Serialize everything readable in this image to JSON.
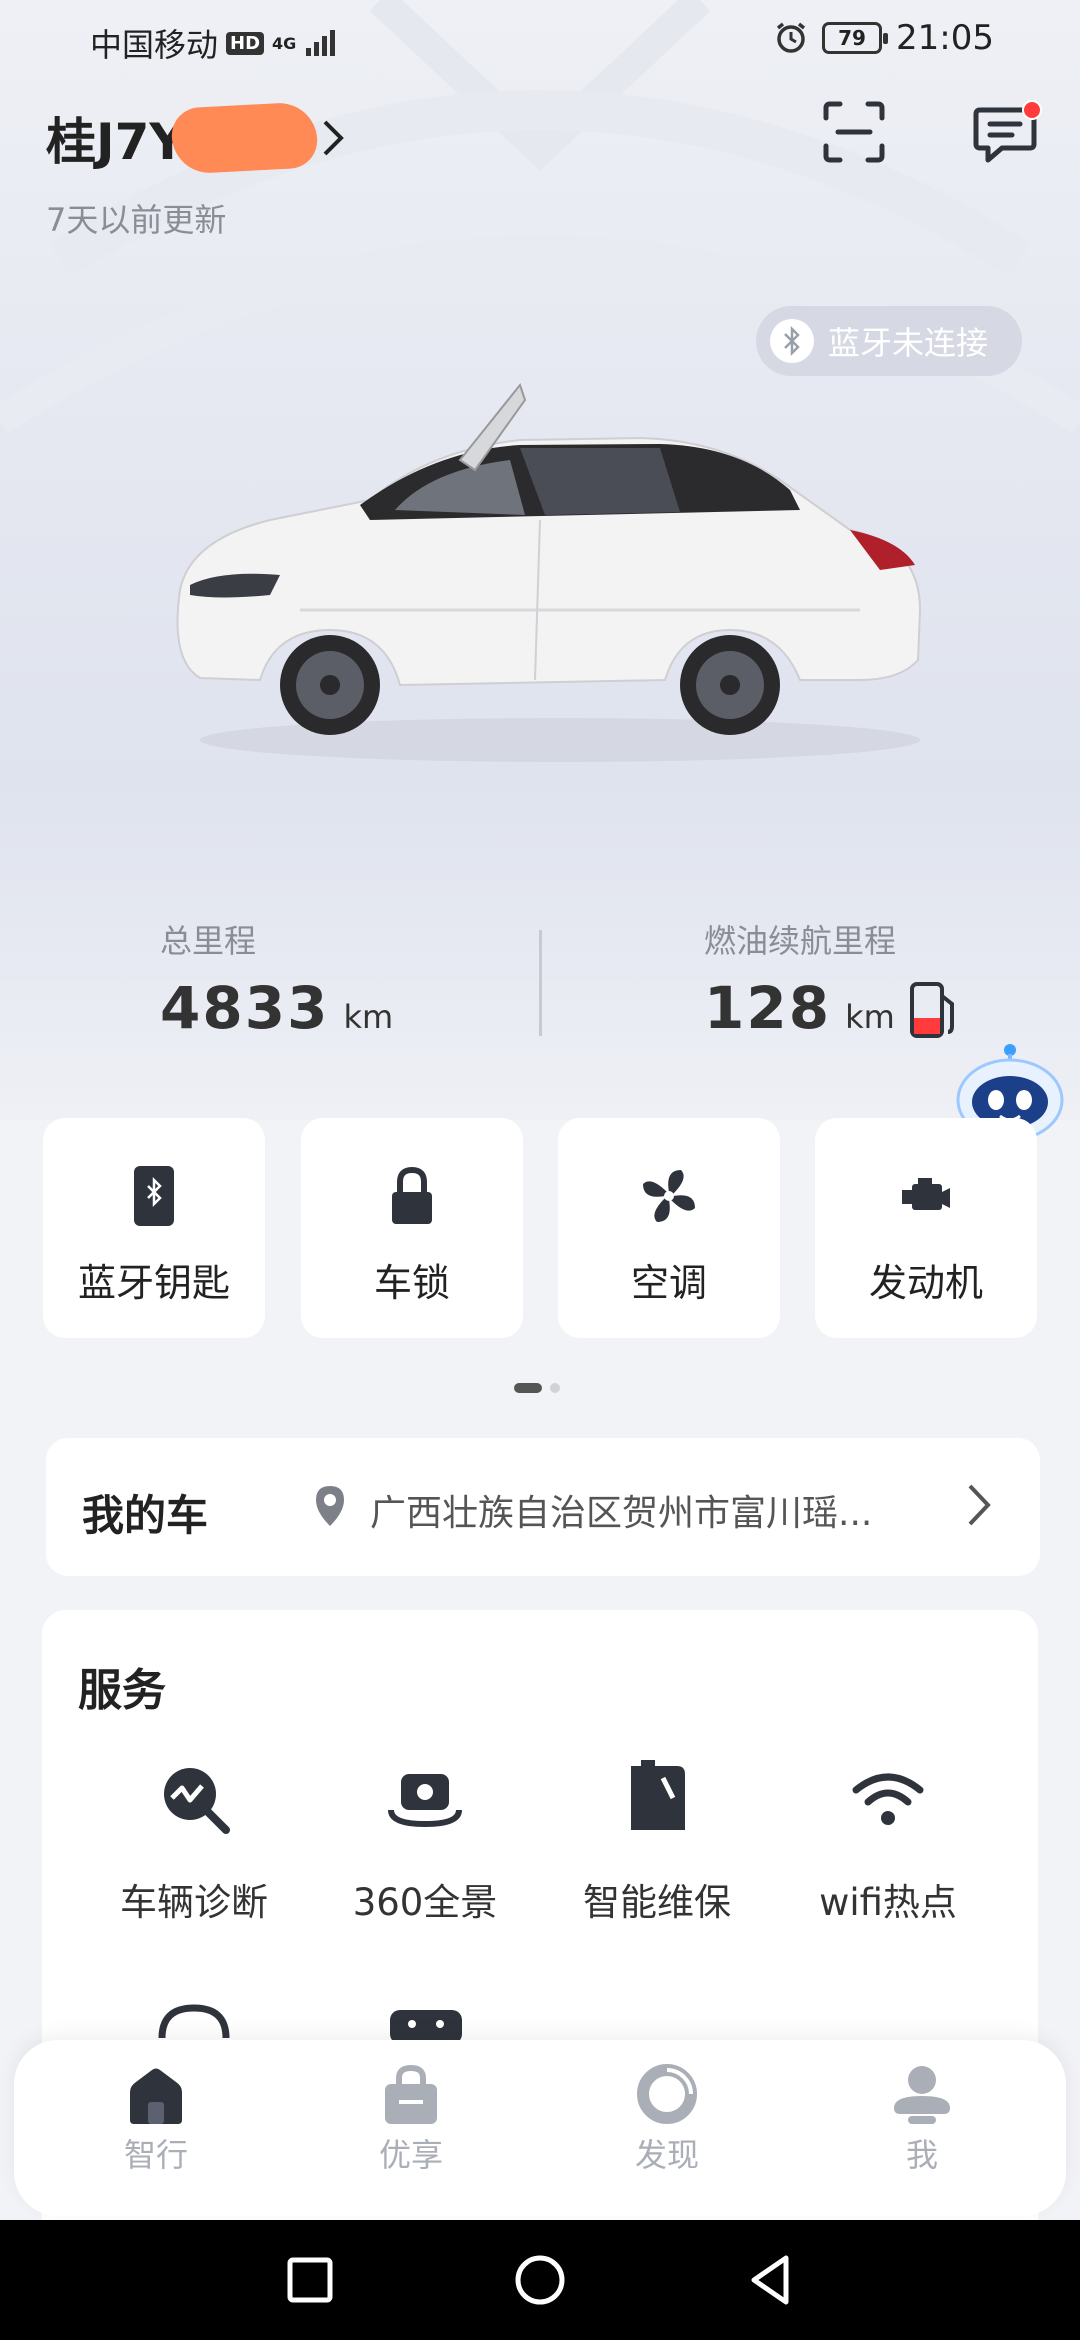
{
  "status_bar": {
    "carrier": "中国移动",
    "hd": "HD",
    "network": "4G",
    "battery": "79",
    "time": "21:05"
  },
  "header": {
    "plate": "桂J7Y",
    "updated": "7天以前更新"
  },
  "bluetooth_status": "蓝牙未连接",
  "stats": {
    "mileage_label": "总里程",
    "mileage_value": "4833",
    "mileage_unit": "km",
    "range_label": "燃油续航里程",
    "range_value": "128",
    "range_unit": "km"
  },
  "quick_actions": [
    {
      "label": "蓝牙钥匙",
      "icon": "bluetooth-key-icon"
    },
    {
      "label": "车锁",
      "icon": "lock-icon"
    },
    {
      "label": "空调",
      "icon": "fan-icon"
    },
    {
      "label": "发动机",
      "icon": "engine-icon"
    }
  ],
  "my_car": {
    "title": "我的车",
    "address": "广西壮族自治区贺州市富川瑶..."
  },
  "services": {
    "title": "服务",
    "items": [
      {
        "label": "车辆诊断",
        "icon": "diagnosis-icon"
      },
      {
        "label": "360全景",
        "icon": "camera-360-icon"
      },
      {
        "label": "智能维保",
        "icon": "maintenance-icon"
      },
      {
        "label": "wifi热点",
        "icon": "wifi-icon"
      }
    ]
  },
  "tabs": [
    {
      "label": "智行",
      "icon": "home-icon"
    },
    {
      "label": "优享",
      "icon": "bag-icon"
    },
    {
      "label": "发现",
      "icon": "discover-icon"
    },
    {
      "label": "我",
      "icon": "profile-icon"
    }
  ],
  "colors": {
    "accent_red": "#ff3b3b",
    "mask_orange": "#ff8a55",
    "icon_dark": "#2f333b",
    "tab_gray": "#aaaeb6"
  }
}
